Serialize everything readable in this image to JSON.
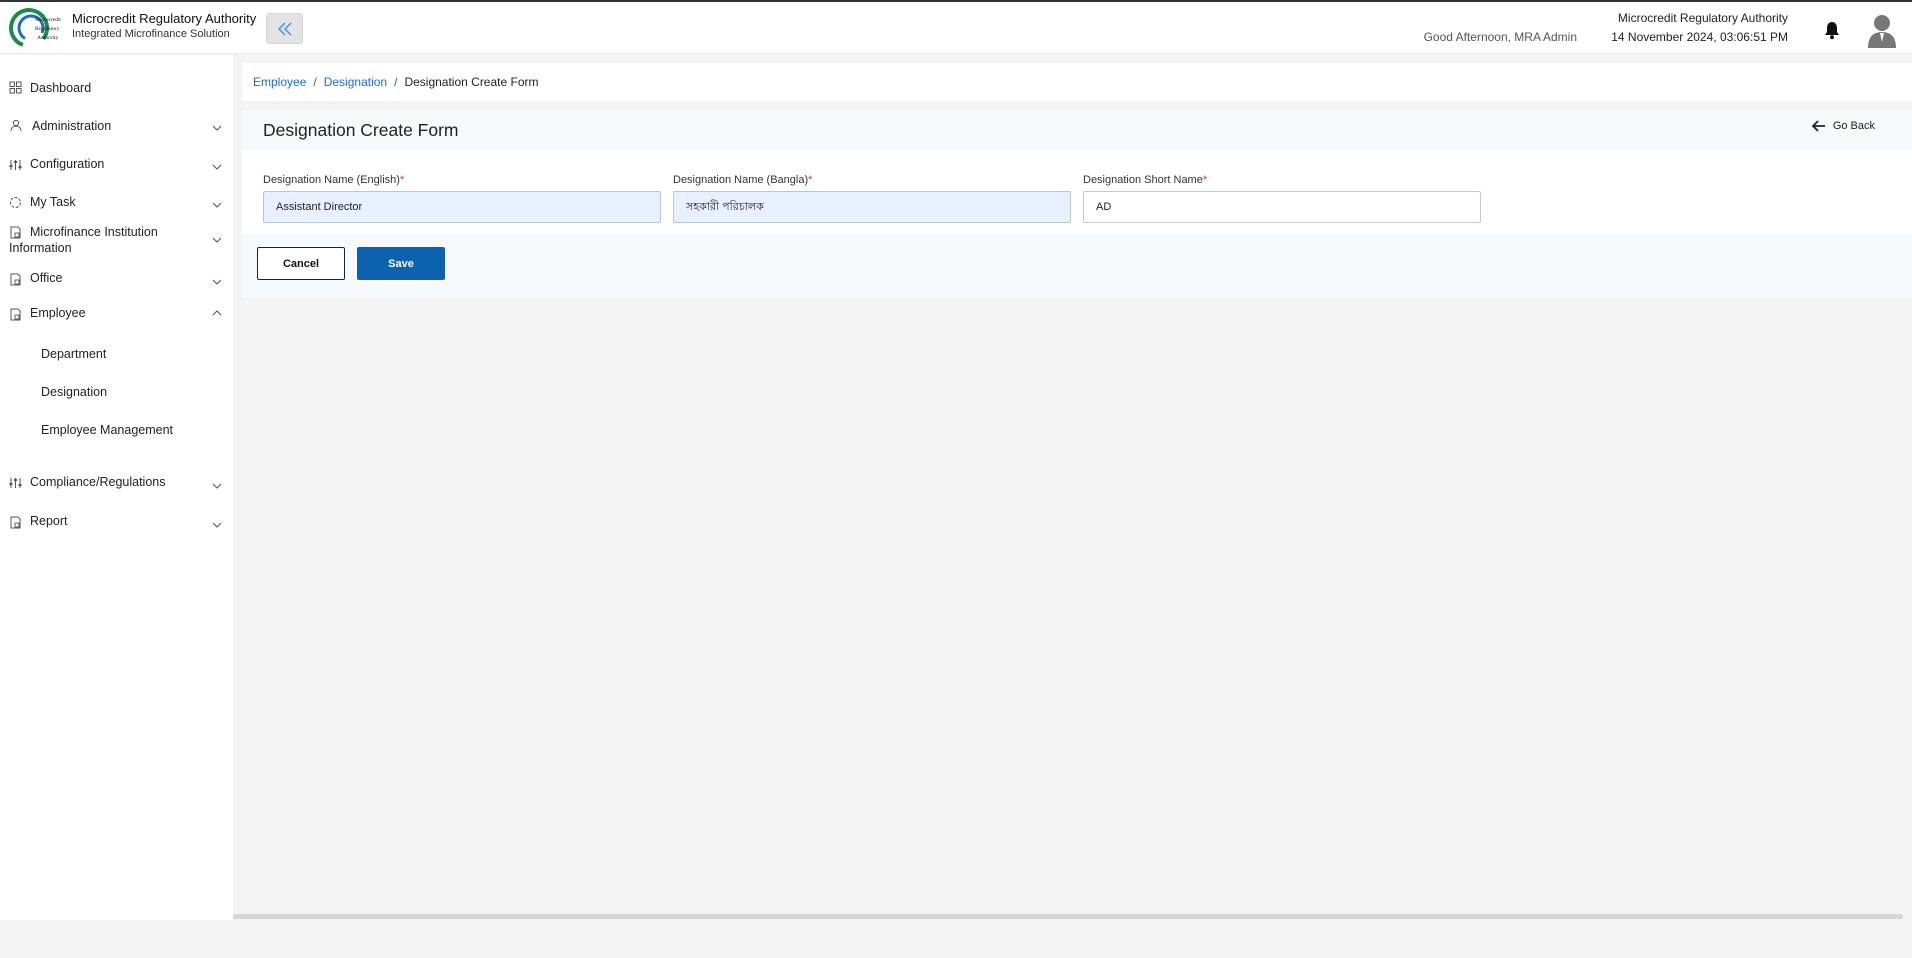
{
  "header": {
    "brand_title": "Microcredit Regulatory Authority",
    "brand_subtitle": "Integrated Microfinance Solution",
    "logo_text": "Microcredit Regulatory Authority",
    "greeting": "Good Afternoon, MRA Admin",
    "org_name": "Microcredit Regulatory Authority",
    "datetime": "14 November 2024, 03:06:51 PM",
    "icons": {
      "collapse": "double-chevron-left-icon",
      "notifications": "bell-icon",
      "avatar": "user-avatar-icon"
    }
  },
  "sidebar": {
    "items": [
      {
        "label": "Dashboard",
        "icon": "grid-icon"
      },
      {
        "label": "Administration",
        "icon": "user-admin-icon"
      },
      {
        "label": "Configuration",
        "icon": "sliders-icon"
      },
      {
        "label": "My Task",
        "icon": "task-circle-icon"
      },
      {
        "label": "Microfinance Institution Information",
        "icon": "document-icon"
      },
      {
        "label": "Office",
        "icon": "document-icon"
      },
      {
        "label": "Employee",
        "icon": "document-icon"
      },
      {
        "label": "Compliance/Regulations",
        "icon": "sliders-icon"
      },
      {
        "label": "Report",
        "icon": "document-icon"
      }
    ],
    "employee_sub": [
      "Department",
      "Designation",
      "Employee Management"
    ]
  },
  "breadcrumb": {
    "level1": "Employee",
    "level2": "Designation",
    "current": "Designation Create Form",
    "separator": "/"
  },
  "form": {
    "title": "Designation Create Form",
    "go_back": "Go Back",
    "fields": [
      {
        "label": "Designation Name (English)",
        "required_mark": "*",
        "value": "Assistant Director"
      },
      {
        "label": "Designation Name (Bangla)",
        "required_mark": "*",
        "value": "সহকারী পরিচালক"
      },
      {
        "label": "Designation Short Name",
        "required_mark": "*",
        "value": "AD"
      }
    ],
    "cancel_label": "Cancel",
    "save_label": "Save"
  },
  "colors": {
    "link": "#1a6fd1",
    "primary": "#0d62b0",
    "required": "#dd3333",
    "logo_green": "#1b8a4a"
  }
}
